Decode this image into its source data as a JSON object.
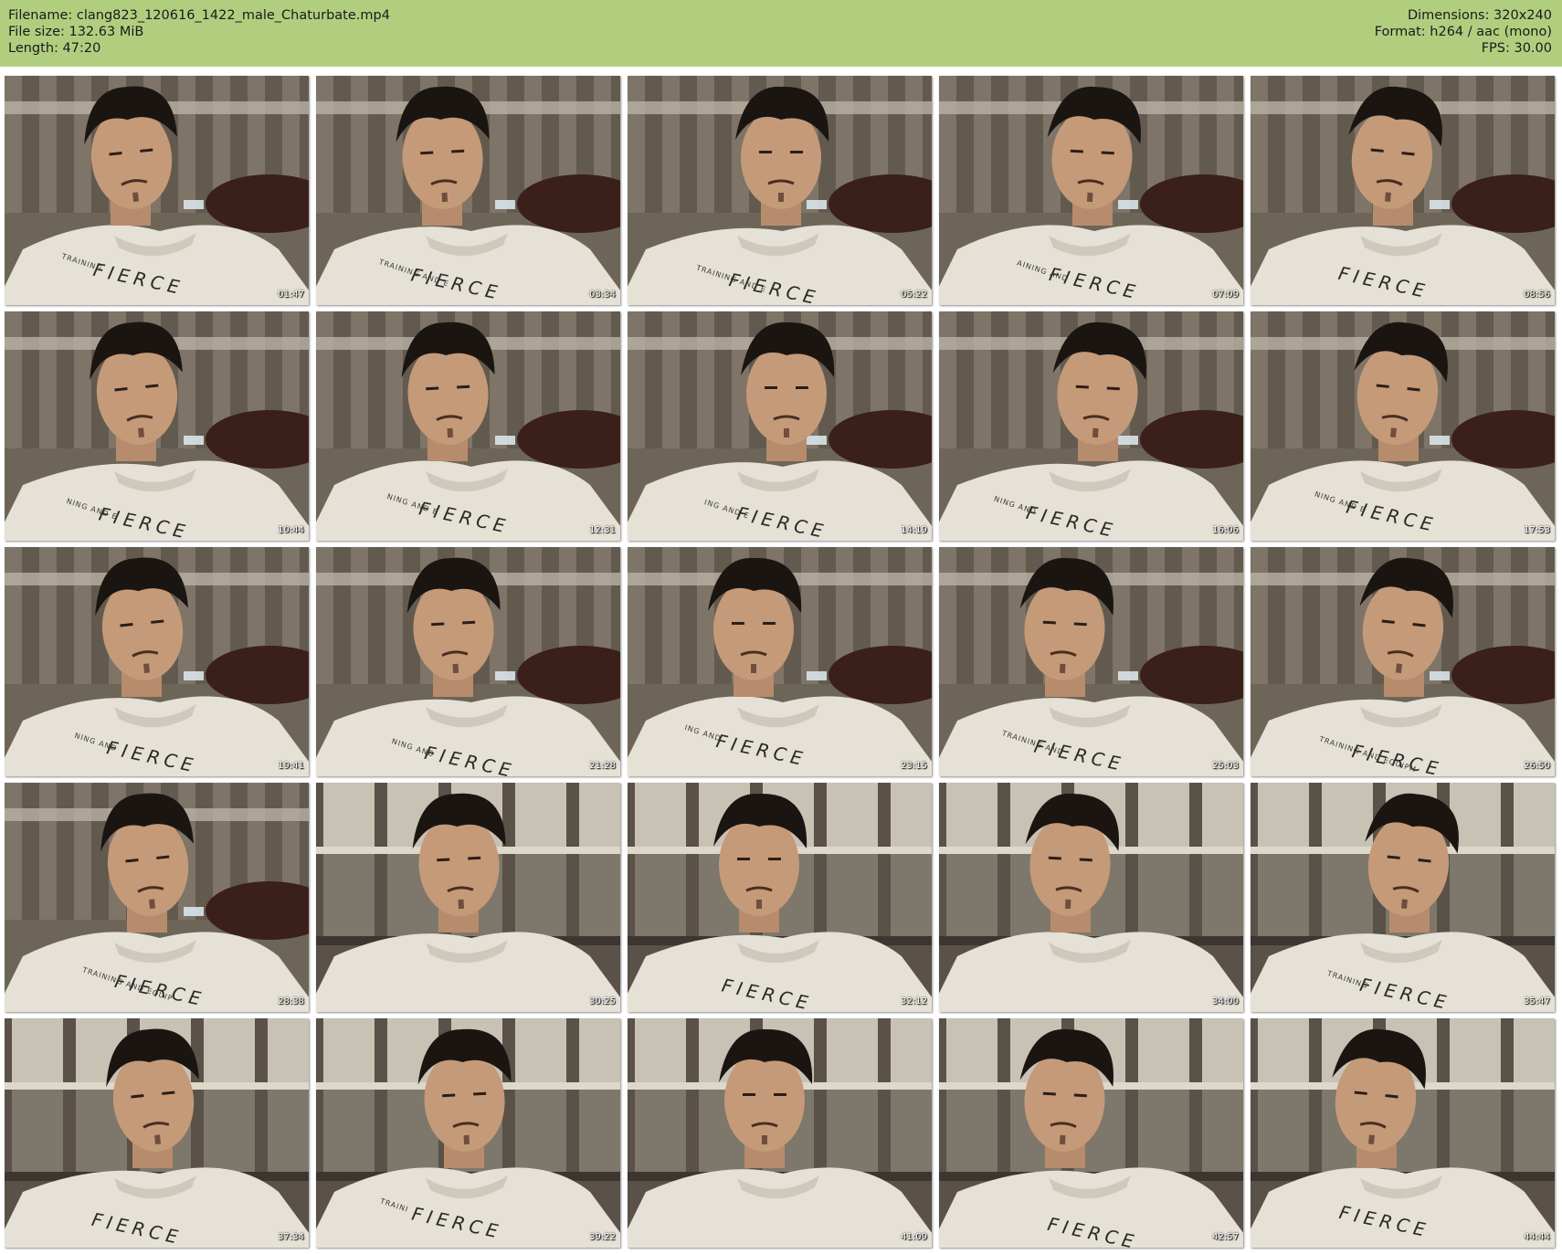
{
  "header": {
    "filename_line": "Filename: clang823_120616_1422_male_Chaturbate.mp4",
    "filesize_line": "File size: 132.63 MiB",
    "length_line": "Length: 47:20",
    "dimensions_line": "Dimensions: 320x240",
    "format_line": "Format: h264 / aac (mono)",
    "fps_line": "FPS: 30.00"
  },
  "colors": {
    "header_background": "#b1ce7f",
    "page_background": "#ffffff",
    "timestamp_text": "#ffffff"
  },
  "thumbnails": [
    {
      "timestamp": "01:47",
      "shirt_text": "FIERCE",
      "shirt_subtext": "TRAINING",
      "scene": "curtain"
    },
    {
      "timestamp": "03:34",
      "shirt_text": "FIERCE",
      "shirt_subtext": "TRAINING AND E",
      "scene": "curtain"
    },
    {
      "timestamp": "05:22",
      "shirt_text": "FIERCE",
      "shirt_subtext": "TRAINING AND E",
      "scene": "curtain"
    },
    {
      "timestamp": "07:09",
      "shirt_text": "FIERCE",
      "shirt_subtext": "AINING AND",
      "scene": "curtain"
    },
    {
      "timestamp": "08:56",
      "shirt_text": "FIERCE",
      "shirt_subtext": "",
      "scene": "curtain"
    },
    {
      "timestamp": "10:44",
      "shirt_text": "FIERCE",
      "shirt_subtext": "NING AND E",
      "scene": "curtain"
    },
    {
      "timestamp": "12:31",
      "shirt_text": "FIERCE",
      "shirt_subtext": "NING AND E",
      "scene": "curtain"
    },
    {
      "timestamp": "14:19",
      "shirt_text": "FIERCE",
      "shirt_subtext": "ING AND E",
      "scene": "curtain"
    },
    {
      "timestamp": "16:06",
      "shirt_text": "FIERCE",
      "shirt_subtext": "NING AND",
      "scene": "curtain"
    },
    {
      "timestamp": "17:53",
      "shirt_text": "FIERCE",
      "shirt_subtext": "NING AND E",
      "scene": "curtain"
    },
    {
      "timestamp": "19:41",
      "shirt_text": "FIERCE",
      "shirt_subtext": "NING AND",
      "scene": "curtain"
    },
    {
      "timestamp": "21:28",
      "shirt_text": "FIERCE",
      "shirt_subtext": "NING AND",
      "scene": "curtain"
    },
    {
      "timestamp": "23:15",
      "shirt_text": "FIERCE",
      "shirt_subtext": "ING AND",
      "scene": "curtain"
    },
    {
      "timestamp": "25:03",
      "shirt_text": "FIERCE",
      "shirt_subtext": "TRAINING AND",
      "scene": "curtain"
    },
    {
      "timestamp": "26:50",
      "shirt_text": "FIERCE",
      "shirt_subtext": "TRAINING AND EQUIPM",
      "scene": "curtain"
    },
    {
      "timestamp": "28:38",
      "shirt_text": "FIERCE",
      "shirt_subtext": "TRAINING AND EQUIP",
      "scene": "curtain"
    },
    {
      "timestamp": "30:25",
      "shirt_text": "",
      "shirt_subtext": "",
      "scene": "window"
    },
    {
      "timestamp": "32:12",
      "shirt_text": "FIERCE",
      "shirt_subtext": "",
      "scene": "window"
    },
    {
      "timestamp": "34:00",
      "shirt_text": "",
      "shirt_subtext": "",
      "scene": "window"
    },
    {
      "timestamp": "35:47",
      "shirt_text": "FIERCE",
      "shirt_subtext": "TRAINING",
      "scene": "window"
    },
    {
      "timestamp": "37:34",
      "shirt_text": "FIERCE",
      "shirt_subtext": "",
      "scene": "window"
    },
    {
      "timestamp": "39:22",
      "shirt_text": "FIERCE",
      "shirt_subtext": "TRAINI",
      "scene": "window"
    },
    {
      "timestamp": "41:09",
      "shirt_text": "",
      "shirt_subtext": "",
      "scene": "window"
    },
    {
      "timestamp": "42:57",
      "shirt_text": "FIERCE",
      "shirt_subtext": "",
      "scene": "window"
    },
    {
      "timestamp": "44:44",
      "shirt_text": "FIERCE",
      "shirt_subtext": "",
      "scene": "window"
    }
  ]
}
